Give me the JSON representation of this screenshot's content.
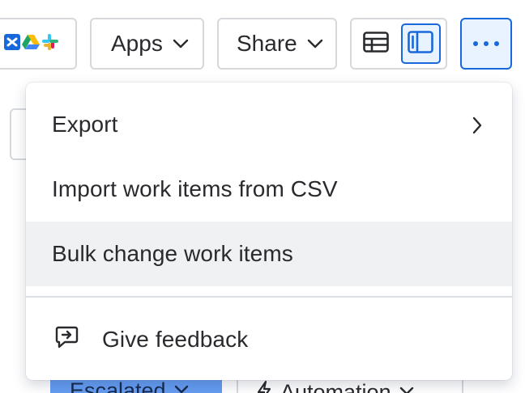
{
  "toolbar": {
    "apps_label": "Apps",
    "share_label": "Share",
    "integration_icons": [
      "confluence-icon",
      "google-drive-icon",
      "slack-icon"
    ],
    "view_options": [
      {
        "name": "table-view-icon",
        "selected": false
      },
      {
        "name": "panel-view-icon",
        "selected": true
      }
    ],
    "more_icon": "more-horizontal-icon"
  },
  "menu": {
    "items": [
      {
        "label": "Export",
        "has_submenu": true
      },
      {
        "label": "Import work items from CSV"
      },
      {
        "label": "Bulk change work items",
        "hovered": true
      },
      {
        "label": "Give feedback",
        "icon": "feedback-icon"
      }
    ]
  },
  "background": {
    "status_chip": "Escalated",
    "automation_label": "Automation"
  },
  "colors": {
    "accent": "#1868db",
    "accent_bg": "#e9f2ff",
    "hover_bg": "#f0f1f2",
    "border": "#d6d8db",
    "status_chip_bg": "#669df1"
  }
}
